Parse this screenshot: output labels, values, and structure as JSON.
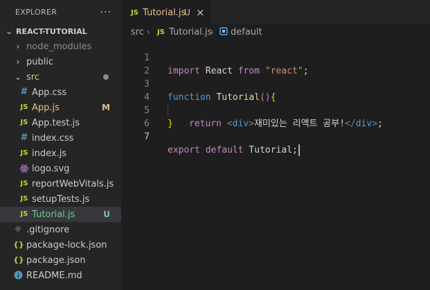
{
  "explorer": {
    "title": "EXPLORER",
    "more": "···"
  },
  "tree": {
    "root": "REACT-TUTORIAL",
    "node_modules": "node_modules",
    "public": "public",
    "src": "src",
    "files": [
      {
        "icon": "#",
        "name": "App.css",
        "deco": ""
      },
      {
        "icon": "JS",
        "name": "App.js",
        "deco": "M"
      },
      {
        "icon": "JS",
        "name": "App.test.js",
        "deco": ""
      },
      {
        "icon": "#",
        "name": "index.css",
        "deco": ""
      },
      {
        "icon": "JS",
        "name": "index.js",
        "deco": ""
      },
      {
        "icon": "react",
        "name": "logo.svg",
        "deco": ""
      },
      {
        "icon": "JS",
        "name": "reportWebVitals.js",
        "deco": ""
      },
      {
        "icon": "JS",
        "name": "setupTests.js",
        "deco": ""
      },
      {
        "icon": "JS",
        "name": "Tutorial.js",
        "deco": "U"
      }
    ],
    "root_files": [
      {
        "icon": "git",
        "name": ".gitignore"
      },
      {
        "icon": "{}",
        "name": "package-lock.json"
      },
      {
        "icon": "{}",
        "name": "package.json"
      },
      {
        "icon": "info",
        "name": "README.md"
      }
    ]
  },
  "tab": {
    "icon": "JS",
    "name": "Tutorial.js",
    "status": "U",
    "close": "×"
  },
  "breadcrumb": {
    "folder": "src",
    "file_icon": "JS",
    "file": "Tutorial.js",
    "symbol": "default"
  },
  "code": {
    "line_numbers": [
      "1",
      "2",
      "3",
      "4",
      "5",
      "6",
      "7"
    ],
    "l1": {
      "kw": "import",
      "name": " React ",
      "from": "from",
      "str": " \"react\"",
      "end": ";"
    },
    "l3": {
      "kw": "function",
      "name": " Tutorial",
      "paren": "()",
      "brace": "{"
    },
    "l4": {
      "kw": "return",
      "open_lt": " <",
      "tag1": "div",
      "open_gt": ">",
      "text": "재미있는 리액트 공부!",
      "close_lt": "</",
      "tag2": "div",
      "close_gt": ">",
      "end": ";"
    },
    "l5": {
      "brace": "}"
    },
    "l7": {
      "kw1": "export",
      "kw2": " default",
      "name": " Tutorial",
      "end": ";"
    }
  },
  "colors": {
    "modified": "#e2c08d",
    "untracked": "#73c991",
    "js_icon": "#cbcb41",
    "css_icon": "#519aba"
  }
}
